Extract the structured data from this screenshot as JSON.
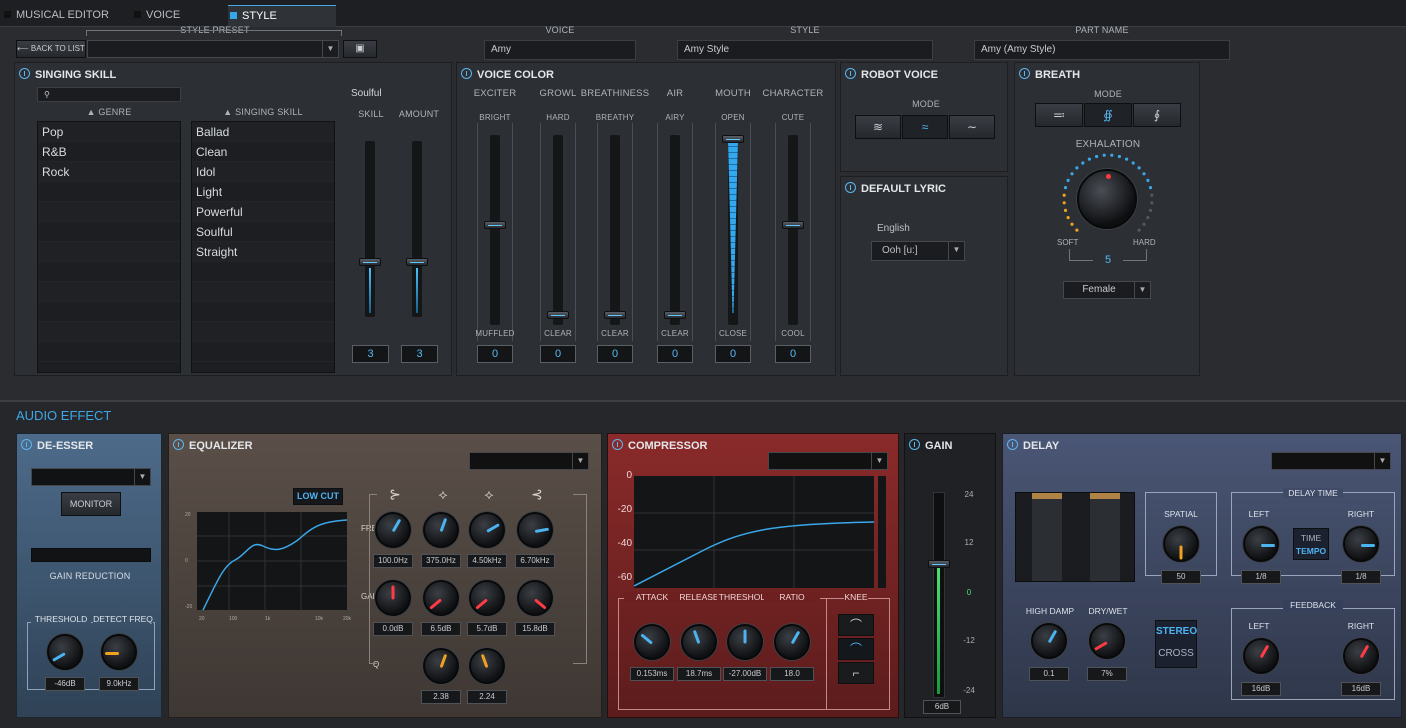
{
  "tabs": [
    {
      "label": "MUSICAL EDITOR"
    },
    {
      "label": "VOICE"
    },
    {
      "label": "STYLE"
    }
  ],
  "top": {
    "style_preset_label": "STYLE PRESET",
    "back_label": "BACK TO LIST",
    "voice_label": "VOICE",
    "voice_value": "Amy",
    "style_label": "STYLE",
    "style_value": "Amy Style",
    "part_label": "PART NAME",
    "part_value": "Amy (Amy Style)"
  },
  "singing": {
    "title": "SINGING SKILL",
    "search_placeholder": "",
    "genre_header": "▲ GENRE",
    "skill_header": "▲ SINGING SKILL",
    "genres": [
      "Pop",
      "R&B",
      "Rock"
    ],
    "skills": [
      "Ballad",
      "Clean",
      "Idol",
      "Light",
      "Powerful",
      "Soulful",
      "Straight"
    ],
    "selected": "Soulful",
    "skill_label": "SKILL",
    "amount_label": "AMOUNT",
    "skill_value": "3",
    "amount_value": "3"
  },
  "voice_color": {
    "title": "VOICE COLOR",
    "sliders": [
      {
        "name": "EXCITER",
        "top": "BRIGHT",
        "bottom": "MUFFLED",
        "value": "0"
      },
      {
        "name": "GROWL",
        "top": "HARD",
        "bottom": "CLEAR",
        "value": "0"
      },
      {
        "name": "BREATHINESS",
        "top": "BREATHY",
        "bottom": "CLEAR",
        "value": "0"
      },
      {
        "name": "AIR",
        "top": "AIRY",
        "bottom": "CLEAR",
        "value": "0"
      },
      {
        "name": "MOUTH",
        "top": "OPEN",
        "bottom": "CLOSE",
        "value": "0"
      },
      {
        "name": "CHARACTER",
        "top": "CUTE",
        "bottom": "COOL",
        "value": "0"
      }
    ]
  },
  "robot": {
    "title": "ROBOT VOICE",
    "mode_label": "MODE"
  },
  "lyric": {
    "title": "DEFAULT LYRIC",
    "language": "English",
    "value": "Ooh [u:]"
  },
  "breath": {
    "title": "BREATH",
    "mode_label": "MODE",
    "exhalation_label": "EXHALATION",
    "soft": "SOFT",
    "hard": "HARD",
    "value": "5",
    "gender": "Female"
  },
  "audio_effect": {
    "title": "AUDIO EFFECT"
  },
  "deesser": {
    "title": "DE-ESSER",
    "monitor": "MONITOR",
    "gain_reduction": "GAIN REDUCTION",
    "threshold_label": "THRESHOLD",
    "detect_label": "DETECT FREQ",
    "threshold_value": "-46dB",
    "detect_value": "9.0kHz"
  },
  "eq": {
    "title": "EQUALIZER",
    "lowcut": "LOW CUT",
    "freq_label": "FREQ",
    "gain_label": "GAIN",
    "q_label": "Q",
    "freqs": [
      "100.0Hz",
      "375.0Hz",
      "4.50kHz",
      "6.70kHz"
    ],
    "gains": [
      "0.0dB",
      "6.5dB",
      "5.7dB",
      "15.8dB"
    ],
    "qs": [
      "2.38",
      "2.24"
    ],
    "graph_x_ticks": [
      "20",
      "100",
      "1k",
      "10k",
      "20k"
    ],
    "graph_y_ticks": [
      "20",
      "0",
      "-20"
    ]
  },
  "comp": {
    "title": "COMPRESSOR",
    "y_ticks": [
      "0",
      "-20",
      "-40",
      "-60"
    ],
    "attack_label": "ATTACK",
    "release_label": "RELEASE",
    "threshold_label": "THRESHOLD",
    "ratio_label": "RATIO",
    "knee_label": "KNEE",
    "attack": "0.153ms",
    "release": "18.7ms",
    "threshold": "-27.00dB",
    "ratio": "18.0"
  },
  "gain": {
    "title": "GAIN",
    "scale": [
      "24",
      "12",
      "0",
      "-12",
      "-24"
    ],
    "value": "6dB"
  },
  "delay": {
    "title": "DELAY",
    "spatial_label": "SPATIAL",
    "spatial_value": "50",
    "delay_time_label": "DELAY TIME",
    "left_label": "LEFT",
    "right_label": "RIGHT",
    "time_label": "TIME",
    "tempo_label": "TEMPO",
    "left_value": "1/8",
    "right_value": "1/8",
    "high_damp_label": "HIGH DAMP",
    "drywet_label": "DRY/WET",
    "high_damp_value": "0.1",
    "drywet_value": "7%",
    "stereo_label": "STEREO",
    "cross_label": "CROSS",
    "feedback_label": "FEEDBACK",
    "fb_left_value": "16dB",
    "fb_right_value": "16dB"
  },
  "colors": {
    "accent": "#36a7ea",
    "deesser_bg": "#4a6683",
    "eq_bg": "#4e4540",
    "comp_bg": "#7a2424",
    "delay_bg": "#3f4a66"
  }
}
